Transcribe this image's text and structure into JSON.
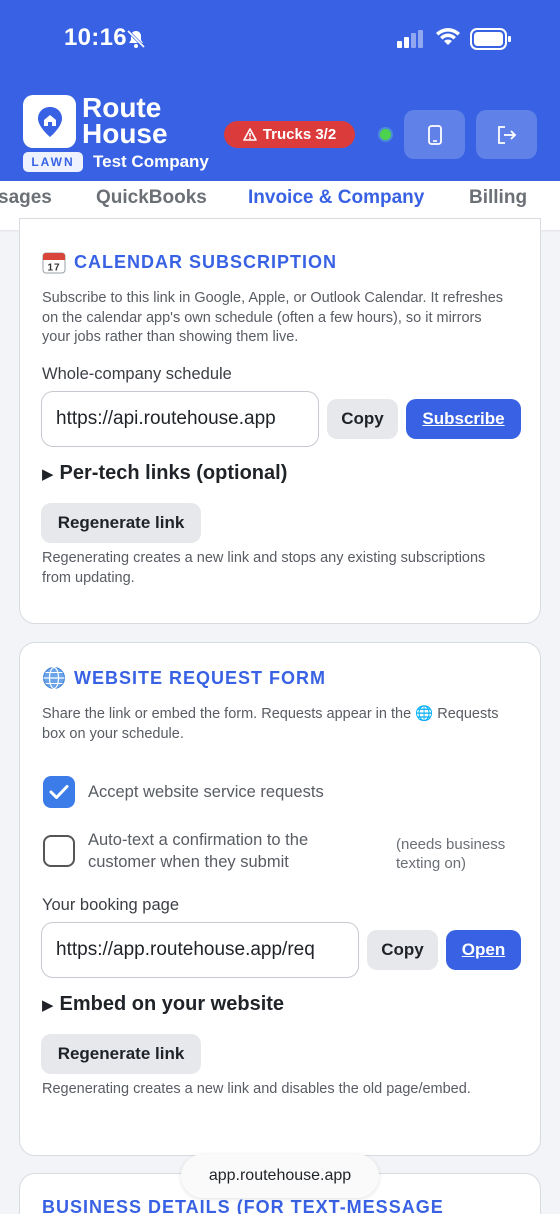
{
  "status_bar": {
    "time": "10:16"
  },
  "header": {
    "brand_line1": "Route",
    "brand_line2": "House",
    "badge": "LAWN",
    "company": "Test Company",
    "trucks_label": "Trucks 3/2",
    "colors": {
      "header_bg": "#3862e3",
      "trucks_bg": "#dc3b3b",
      "online": "#4cd24c"
    }
  },
  "tabs": [
    {
      "label": "sages",
      "active": false
    },
    {
      "label": "QuickBooks",
      "active": false
    },
    {
      "label": "Invoice & Company",
      "active": true
    },
    {
      "label": "Billing",
      "active": false
    }
  ],
  "calendar": {
    "icon": "calendar-icon",
    "title": "CALENDAR SUBSCRIPTION",
    "description": "Subscribe to this link in Google, Apple, or Outlook Calendar. It refreshes on the calendar app's own schedule (often a few hours), so it mirrors your jobs rather than showing them live.",
    "schedule_label": "Whole-company schedule",
    "url_value": "https://api.routehouse.app",
    "copy_label": "Copy",
    "subscribe_label": "Subscribe",
    "per_tech_label": "Per-tech links (optional)",
    "regenerate_label": "Regenerate link",
    "regenerate_note": "Regenerating creates a new link and stops any existing subscriptions from updating."
  },
  "website_form": {
    "icon": "globe-icon",
    "title": "WEBSITE REQUEST FORM",
    "description": "Share the link or embed the form. Requests appear in the 🌐 Requests box on your schedule.",
    "accept_label": "Accept website service requests",
    "accept_checked": true,
    "autotext_label_line1": "Auto-text a confirmation to the",
    "autotext_label_line2": "customer when they submit",
    "autotext_checked": false,
    "autotext_hint_line1": "(needs business",
    "autotext_hint_line2": "texting on)",
    "booking_label": "Your booking page",
    "booking_url": "https://app.routehouse.app/req",
    "copy_label": "Copy",
    "open_label": "Open",
    "embed_label": "Embed on your website",
    "regenerate_label": "Regenerate link",
    "regenerate_note": "Regenerating creates a new link and disables the old page/embed."
  },
  "business_details": {
    "title": "BUSINESS DETAILS (FOR TEXT-MESSAGE"
  },
  "browser": {
    "url": "app.routehouse.app"
  }
}
